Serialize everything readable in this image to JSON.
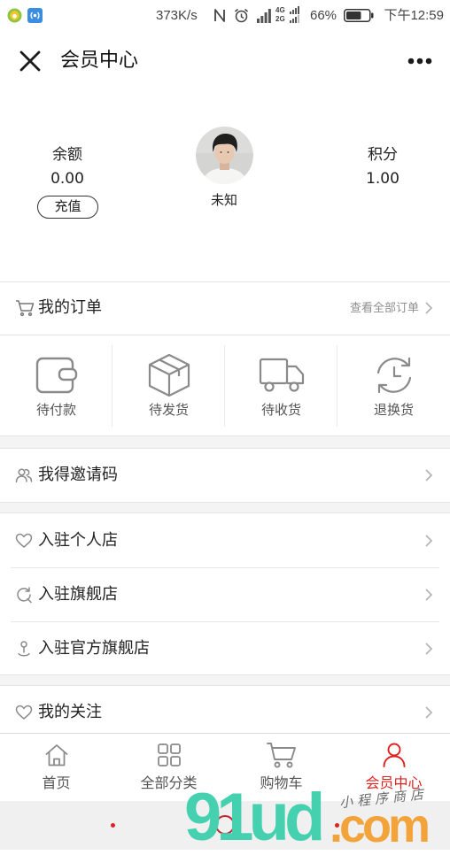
{
  "status_bar": {
    "network_speed": "373K/s",
    "network_type_1": "4G",
    "network_type_2": "2G",
    "battery": "66%",
    "time": "下午12:59",
    "icons": [
      "app-notification-icon",
      "hotspot-icon",
      "nfc-icon",
      "alarm-icon",
      "signal-icon",
      "battery-icon"
    ]
  },
  "header": {
    "title": "会员中心",
    "left_icon": "close-icon",
    "right_icon": "more-icon"
  },
  "profile": {
    "balance_label": "余额",
    "balance_value": "0.00",
    "recharge_label": "充值",
    "username": "未知",
    "points_label": "积分",
    "points_value": "1.00"
  },
  "orders": {
    "icon": "cart-icon",
    "title": "我的订单",
    "view_all_label": "查看全部订单",
    "statuses": [
      {
        "label": "待付款",
        "icon": "wallet-icon"
      },
      {
        "label": "待发货",
        "icon": "package-icon"
      },
      {
        "label": "待收货",
        "icon": "truck-icon"
      },
      {
        "label": "退换货",
        "icon": "return-exchange-icon"
      }
    ]
  },
  "menu_groups": [
    {
      "items": [
        {
          "label": "我得邀请码",
          "icon": "invite-people-icon"
        }
      ]
    },
    {
      "items": [
        {
          "label": "入驻个人店",
          "icon": "heart-icon"
        },
        {
          "label": "入驻旗舰店",
          "icon": "flagship-store-icon"
        },
        {
          "label": "入驻官方旗舰店",
          "icon": "official-store-icon"
        }
      ]
    },
    {
      "items": [
        {
          "label": "我的关注",
          "icon": "heart-icon"
        }
      ]
    }
  ],
  "tab_bar": {
    "active_index": 3,
    "items": [
      {
        "label": "首页",
        "icon": "home-icon"
      },
      {
        "label": "全部分类",
        "icon": "category-grid-icon"
      },
      {
        "label": "购物车",
        "icon": "cart-icon"
      },
      {
        "label": "会员中心",
        "icon": "user-icon"
      }
    ]
  },
  "watermark": {
    "brand": "91ud",
    "suffix": ".com",
    "tagline": "小程序商店"
  },
  "colors": {
    "accent": "#e0221f",
    "text": "#1f1f1f",
    "muted": "#8e8e8e",
    "icon_gray": "#8a8a8a",
    "watermark_green": "#45d1b0",
    "watermark_orange": "#f2a33a"
  }
}
